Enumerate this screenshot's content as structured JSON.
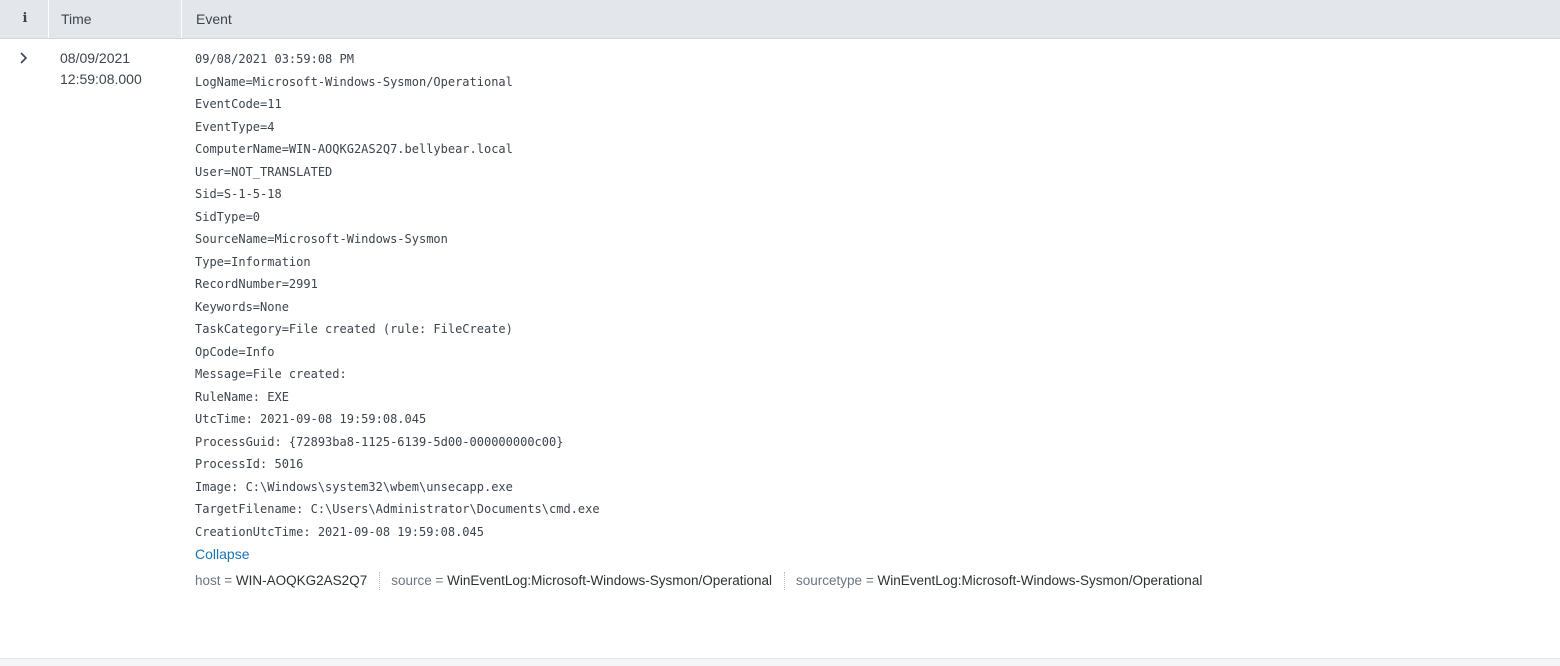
{
  "header": {
    "info_label": "i",
    "time_label": "Time",
    "event_label": "Event"
  },
  "row": {
    "time_date": "08/09/2021",
    "time_clock": "12:59:08.000",
    "raw_lines": [
      "09/08/2021 03:59:08 PM",
      "LogName=Microsoft-Windows-Sysmon/Operational",
      "EventCode=11",
      "EventType=4",
      "ComputerName=WIN-AOQKG2AS2Q7.bellybear.local",
      "User=NOT_TRANSLATED",
      "Sid=S-1-5-18",
      "SidType=0",
      "SourceName=Microsoft-Windows-Sysmon",
      "Type=Information",
      "RecordNumber=2991",
      "Keywords=None",
      "TaskCategory=File created (rule: FileCreate)",
      "OpCode=Info",
      "Message=File created:",
      "RuleName: EXE",
      "UtcTime: 2021-09-08 19:59:08.045",
      "ProcessGuid: {72893ba8-1125-6139-5d00-000000000c00}",
      "ProcessId: 5016",
      "Image: C:\\Windows\\system32\\wbem\\unsecapp.exe",
      "TargetFilename: C:\\Users\\Administrator\\Documents\\cmd.exe",
      "CreationUtcTime: 2021-09-08 19:59:08.045"
    ],
    "collapse_label": "Collapse",
    "fields": [
      {
        "key": "host",
        "value": "WIN-AOQKG2AS2Q7"
      },
      {
        "key": "source",
        "value": "WinEventLog:Microsoft-Windows-Sysmon/Operational"
      },
      {
        "key": "sourcetype",
        "value": "WinEventLog:Microsoft-Windows-Sysmon/Operational"
      }
    ]
  },
  "icons": {
    "expand": "chevron-right-icon",
    "info": "info-icon"
  },
  "colors": {
    "header_bg": "#e3e7eb",
    "link": "#1a73b5",
    "text": "#3c444d"
  }
}
